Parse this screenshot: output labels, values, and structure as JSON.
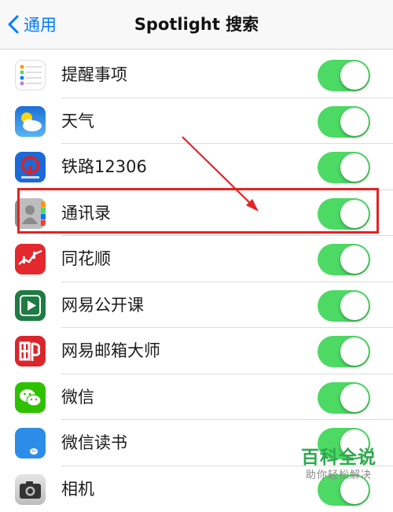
{
  "navbar": {
    "back_label": "通用",
    "title": "Spotlight 搜索"
  },
  "apps": [
    {
      "label": "提醒事项",
      "icon": "reminders-icon",
      "enabled": true
    },
    {
      "label": "天气",
      "icon": "weather-icon",
      "enabled": true
    },
    {
      "label": "铁路12306",
      "icon": "railway-icon",
      "enabled": true
    },
    {
      "label": "通讯录",
      "icon": "contacts-icon",
      "enabled": true,
      "highlighted": true
    },
    {
      "label": "同花顺",
      "icon": "tonghuashun-icon",
      "enabled": true
    },
    {
      "label": "网易公开课",
      "icon": "netease-open-course-icon",
      "enabled": true
    },
    {
      "label": "网易邮箱大师",
      "icon": "netease-mail-master-icon",
      "enabled": true
    },
    {
      "label": "微信",
      "icon": "wechat-icon",
      "enabled": true
    },
    {
      "label": "微信读书",
      "icon": "wechat-read-icon",
      "enabled": true
    },
    {
      "label": "相机",
      "icon": "camera-icon",
      "enabled": true
    }
  ],
  "colors": {
    "accent": "#007aff",
    "toggle_on": "#4cd964",
    "highlight": "#e62222",
    "watermark": "#2fa84f"
  },
  "watermark": {
    "main": "百科全说",
    "sub": "助你轻松解决"
  }
}
